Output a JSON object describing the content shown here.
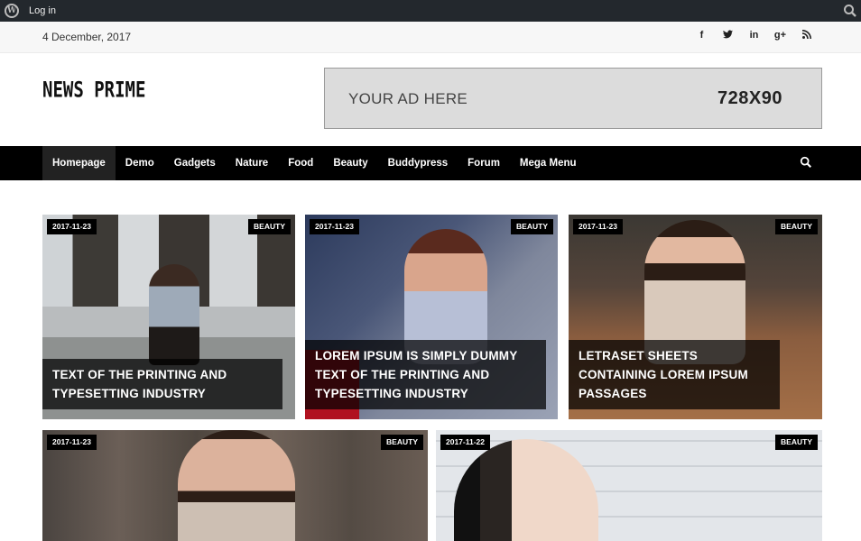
{
  "admin_bar": {
    "login": "Log in"
  },
  "top_bar": {
    "date": "4 December, 2017",
    "social": [
      "f",
      "t",
      "in",
      "g+",
      "rss"
    ]
  },
  "header": {
    "logo": "NEWS PRIME",
    "ad": {
      "text": "YOUR AD HERE",
      "size": "728X90"
    }
  },
  "nav": {
    "items": [
      "Homepage",
      "Demo",
      "Gadgets",
      "Nature",
      "Food",
      "Beauty",
      "Buddypress",
      "Forum",
      "Mega Menu"
    ],
    "active": "Homepage"
  },
  "posts": [
    {
      "date": "2017-11-23",
      "category": "BEAUTY",
      "title": "TEXT OF THE PRINTING AND TYPESETTING INDUSTRY"
    },
    {
      "date": "2017-11-23",
      "category": "BEAUTY",
      "title": "LOREM IPSUM IS SIMPLY DUMMY TEXT OF THE PRINTING AND TYPESETTING INDUSTRY"
    },
    {
      "date": "2017-11-23",
      "category": "BEAUTY",
      "title": "LETRASET SHEETS CONTAINING LOREM IPSUM PASSAGES"
    },
    {
      "date": "2017-11-23",
      "category": "BEAUTY",
      "title": ""
    },
    {
      "date": "2017-11-22",
      "category": "BEAUTY",
      "title": ""
    }
  ],
  "colors": {
    "admin_bar": "#23282d",
    "nav": "#000000",
    "nav_active": "#222222"
  }
}
